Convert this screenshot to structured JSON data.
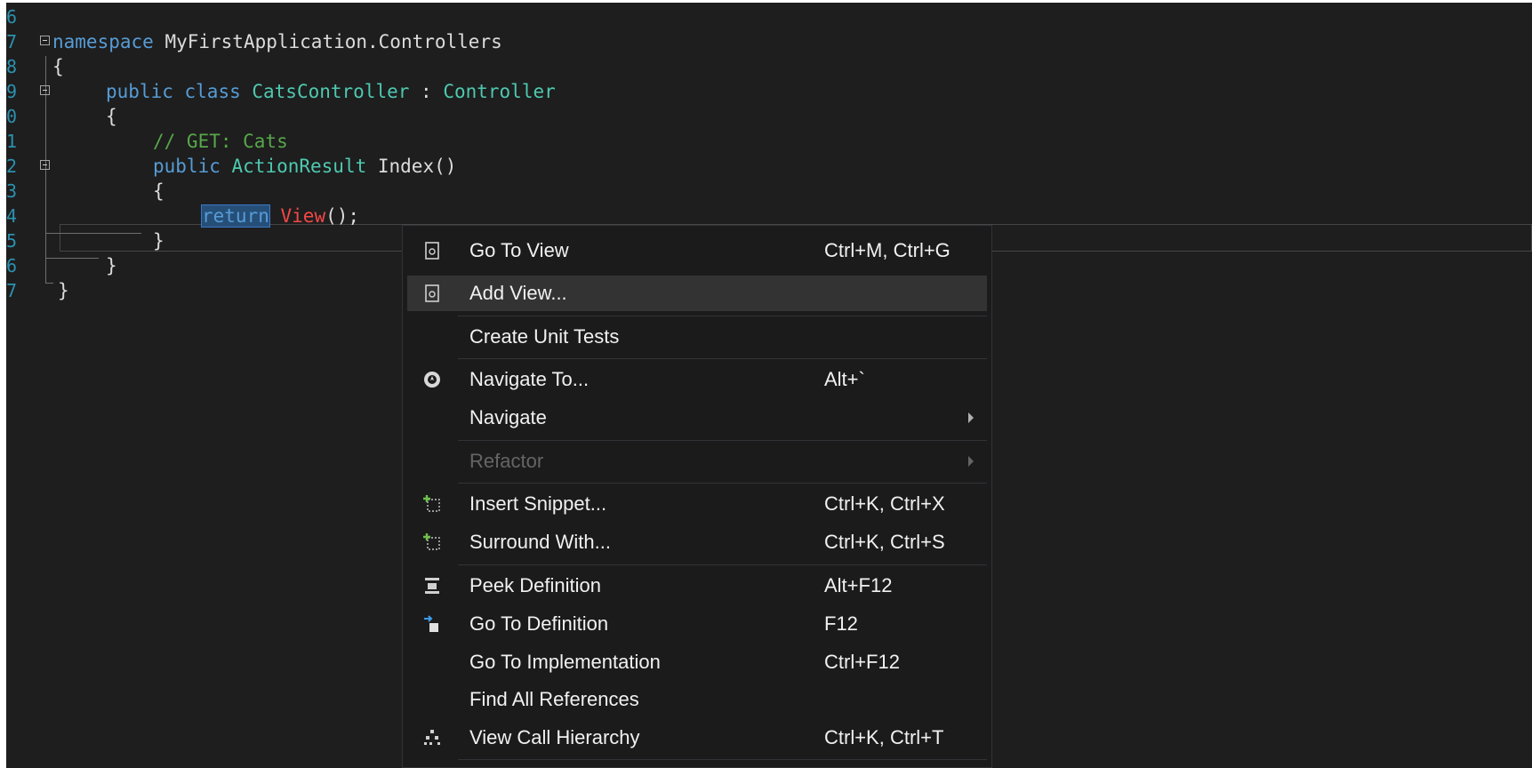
{
  "editor": {
    "lines": [
      {
        "number": "6"
      },
      {
        "number": "7",
        "keyword": "namespace",
        "name": " MyFirstApplication.Controllers"
      },
      {
        "number": "8",
        "text": "{"
      },
      {
        "number": "9",
        "mod": "public",
        "cls": "class",
        "name": " CatsController",
        "colon": " : ",
        "base": "Controller"
      },
      {
        "number": "0",
        "text": "{"
      },
      {
        "number": "1",
        "comment": "// GET: Cats"
      },
      {
        "number": "2",
        "mod": "public",
        "type": "ActionResult",
        "rest": " Index()"
      },
      {
        "number": "3",
        "text": "{"
      },
      {
        "number": "4",
        "ret": "return",
        "call": "View",
        "rest": "();"
      },
      {
        "number": "5",
        "text": "}"
      },
      {
        "number": "6",
        "text": "}"
      },
      {
        "number": "7",
        "text": "}"
      }
    ]
  },
  "context_menu": {
    "items": [
      {
        "label": "Go To View",
        "shortcut": "Ctrl+M, Ctrl+G",
        "icon": "view-page-icon"
      },
      {
        "label": "Add View...",
        "shortcut": "",
        "icon": "view-page-icon",
        "highlighted": true
      },
      {
        "label": "Create Unit Tests",
        "shortcut": ""
      },
      {
        "label": "Navigate To...",
        "shortcut": "Alt+`",
        "icon": "navigate-compass-icon"
      },
      {
        "label": "Navigate",
        "shortcut": "",
        "submenu": true
      },
      {
        "label": "Refactor",
        "shortcut": "",
        "submenu": true,
        "disabled": true
      },
      {
        "label": "Insert Snippet...",
        "shortcut": "Ctrl+K, Ctrl+X",
        "icon": "insert-snippet-icon"
      },
      {
        "label": "Surround With...",
        "shortcut": "Ctrl+K, Ctrl+S",
        "icon": "surround-with-icon"
      },
      {
        "label": "Peek Definition",
        "shortcut": "Alt+F12",
        "icon": "peek-definition-icon"
      },
      {
        "label": "Go To Definition",
        "shortcut": "F12",
        "icon": "go-to-definition-icon"
      },
      {
        "label": "Go To Implementation",
        "shortcut": "Ctrl+F12"
      },
      {
        "label": "Find All References",
        "shortcut": ""
      },
      {
        "label": "View Call Hierarchy",
        "shortcut": "Ctrl+K, Ctrl+T",
        "icon": "call-hierarchy-icon"
      }
    ]
  },
  "colors": {
    "editor_bg": "#1e1e1e",
    "keyword": "#569cd6",
    "type": "#4ec9b0",
    "comment": "#57a64a",
    "error": "#f44747",
    "line_number": "#2b91af",
    "menu_bg": "#1b1b1c",
    "menu_highlight": "#333334"
  }
}
